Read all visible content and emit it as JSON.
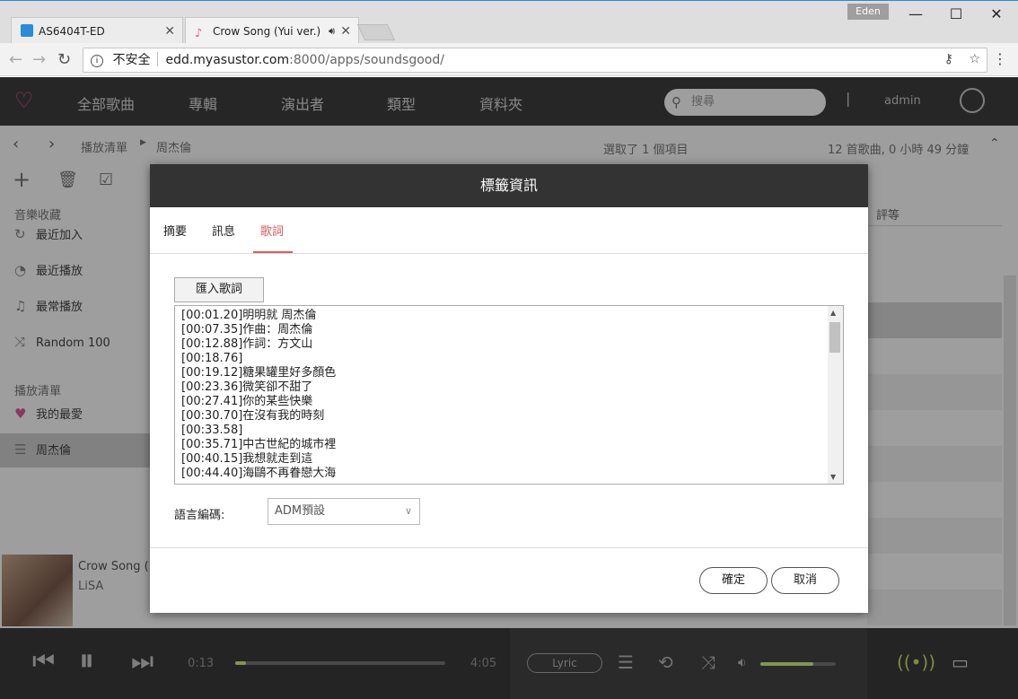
{
  "browser": {
    "tabs": [
      {
        "label": "AS6404T-ED"
      },
      {
        "label": "Crow Song (Yui ver.)"
      }
    ],
    "profile_badge": "Eden",
    "window_controls": {
      "minimize": "—",
      "maximize": "☐",
      "close": "✕"
    },
    "security_label": "不安全",
    "url_host": "edd.myasustor.com",
    "url_rest": ":8000/apps/soundsgood/"
  },
  "app": {
    "nav": [
      "全部歌曲",
      "專輯",
      "演出者",
      "類型",
      "資料夾"
    ],
    "search_placeholder": "搜尋",
    "user": "admin",
    "breadcrumb": [
      "播放清單",
      "周杰倫"
    ],
    "selection_text": "選取了 1 個項目",
    "summary_text": "12 首歌曲, 0 小時 49 分鐘",
    "column_rating": "評等",
    "sidebar": {
      "section1": "音樂收藏",
      "items1": [
        "最近加入",
        "最近播放",
        "最常播放",
        "Random 100"
      ],
      "section2": "播放清單",
      "items2": [
        "我的最愛",
        "周杰倫"
      ]
    },
    "now_playing": {
      "title": "Crow Song (",
      "artist": "LiSA"
    },
    "player": {
      "elapsed": "0:13",
      "total": "4:05",
      "lyric_btn": "Lyric",
      "progress": 0.05,
      "volume": 0.7
    }
  },
  "dialog": {
    "title": "標籤資訊",
    "tabs": [
      "摘要",
      "訊息",
      "歌詞"
    ],
    "active_tab": "歌詞",
    "import_button": "匯入歌詞",
    "lyrics_lines": [
      "[00:01.20]明明就 周杰倫",
      "[00:07.35]作曲：周杰倫",
      "[00:12.88]作詞：方文山",
      "[00:18.76]",
      "[00:19.12]糖果罐里好多顏色",
      "[00:23.36]微笑卻不甜了",
      "[00:27.41]你的某些快樂",
      "[00:30.70]在沒有我的時刻",
      "[00:33.58]",
      "[00:35.71]中古世紀的城市裡",
      "[00:40.15]我想就走到這",
      "[00:44.40]海鷗不再眷戀大海"
    ],
    "encoding_label": "語言編碼:",
    "encoding_value": "ADM預設",
    "ok_button": "確定",
    "cancel_button": "取消"
  },
  "colors": {
    "accent": "#e05a5a",
    "header": "#333333",
    "chrome_accent": "#2a8bd8"
  }
}
